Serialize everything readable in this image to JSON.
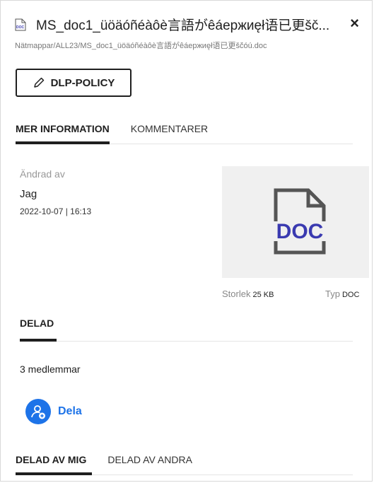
{
  "header": {
    "title": "MS_doc1_üöäóñéàôè言語がêáeржиęł语已更šč...",
    "path": "Nätmappar/ALL23/MS_doc1_üöäóñéàôè言語がêáeржиęł语已更šč́óú.doc",
    "close_glyph": "×",
    "file_icon": "doc-file-icon",
    "file_icon_text": "DOC"
  },
  "actions": {
    "dlp_label": "DLP-POLICY"
  },
  "info_tabs": [
    {
      "label": "MER INFORMATION",
      "active": true
    },
    {
      "label": "KOMMENTARER",
      "active": false
    }
  ],
  "details": {
    "modified_label": "Ändrad av",
    "modified_by": "Jag",
    "modified_date": "2022-10-07 | 16:13",
    "thumbnail_text": "DOC",
    "size_label": "Storlek",
    "size_value": "25 KB",
    "type_label": "Typ",
    "type_value": "DOC"
  },
  "shared": {
    "heading": "DELAD",
    "members": "3 medlemmar",
    "share_label": "Dela"
  },
  "shared_tabs": [
    {
      "label": "DELAD AV MIG",
      "active": true
    },
    {
      "label": "DELAD AV ANDRA",
      "active": false
    }
  ],
  "colors": {
    "accent": "#1d73e8",
    "thumb_icon": "#3a3ab0",
    "text": "#1f1f1f"
  }
}
